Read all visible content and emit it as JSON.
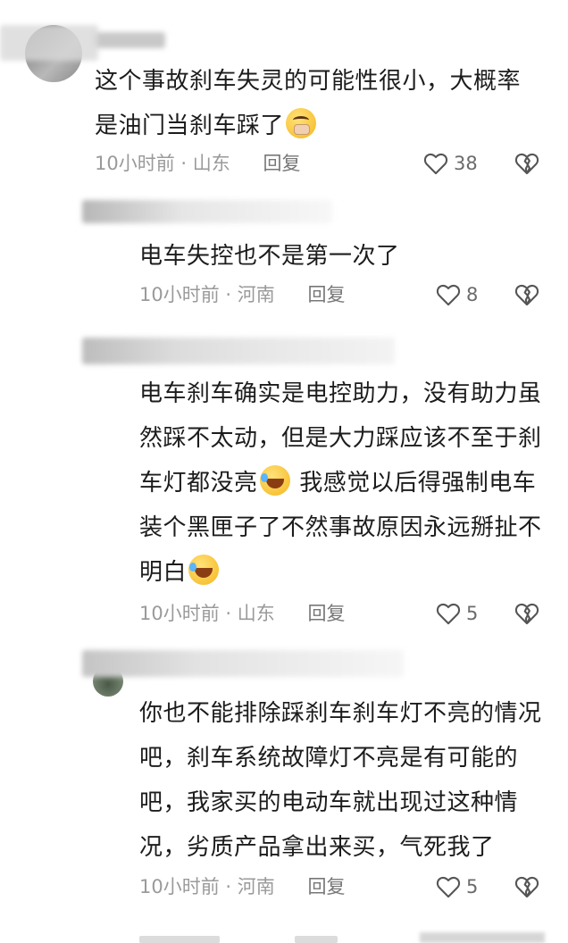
{
  "comments": [
    {
      "text": "这个事故刹车失灵的可能性很小，大概率是油门当刹车踩了",
      "line1": "这个事故刹车失灵的可能性很小，大概率",
      "line2": "是油门当刹车踩了",
      "emoji": "pleading-face-icon",
      "time": "10小时前",
      "location": "山东",
      "reply_label": "回复",
      "likes": "38"
    },
    {
      "text": "电车失控也不是第一次了",
      "line1": "电车失控也不是第一次了",
      "time": "10小时前",
      "location": "河南",
      "reply_label": "回复",
      "likes": "8"
    },
    {
      "line1": "电车刹车确实是电控助力，没有助力虽",
      "line2": "然踩不太动，但是大力踩应该不至于刹",
      "line3": "车灯都没亮",
      "line3b": " 我感觉以后得强制电车",
      "line4": "装个黑匣子了不然事故原因永远掰扯不",
      "line5": "明白",
      "emoji": "rolling-laugh-icon",
      "time": "10小时前",
      "location": "山东",
      "reply_label": "回复",
      "likes": "5"
    },
    {
      "line1": "你也不能排除踩刹车刹车灯不亮的情况",
      "line2": "吧，刹车系统故障灯不亮是有可能的",
      "line3": "吧，我家买的电动车就出现过这种情",
      "line4": "况，劣质产品拿出来买，气死我了",
      "time": "10小时前",
      "location": "河南",
      "reply_label": "回复",
      "likes": "5"
    }
  ],
  "colors": {
    "text": "#1c1c1c",
    "meta": "#9a9a9a",
    "icon": "#555555"
  }
}
